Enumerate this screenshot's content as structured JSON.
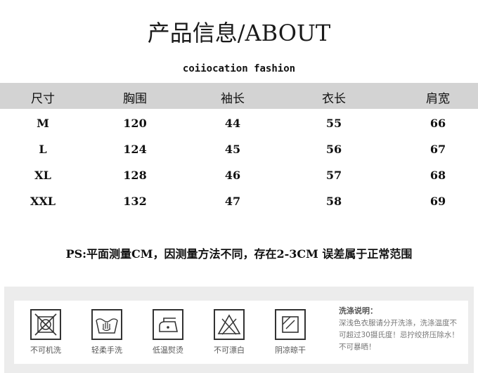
{
  "title": "产品信息/ABOUT",
  "subtitle": "coiiocation fashion",
  "table": {
    "headers": [
      "尺寸",
      "胸围",
      "袖长",
      "衣长",
      "肩宽"
    ],
    "rows": [
      [
        "M",
        "120",
        "44",
        "55",
        "66"
      ],
      [
        "L",
        "124",
        "45",
        "56",
        "67"
      ],
      [
        "XL",
        "128",
        "46",
        "57",
        "68"
      ],
      [
        "XXL",
        "132",
        "47",
        "58",
        "69"
      ]
    ]
  },
  "note": "PS:平面测量CM，因测量方法不同，存在2-3CM 误差属于正常范围",
  "care": {
    "items": [
      {
        "icon": "no-machine-wash-icon",
        "label": "不可机洗"
      },
      {
        "icon": "gentle-hand-wash-icon",
        "label": "轻柔手洗"
      },
      {
        "icon": "low-temp-iron-icon",
        "label": "低温熨烫"
      },
      {
        "icon": "no-bleach-icon",
        "label": "不可漂白"
      },
      {
        "icon": "shade-dry-icon",
        "label": "阴凉晾干"
      }
    ],
    "wash_title": "洗涤说明：",
    "wash_text": "深浅色衣服请分开洗涤，洗涤温度不可超过30摄氏度！忌拧绞挤压除水！不可暴晒！"
  }
}
